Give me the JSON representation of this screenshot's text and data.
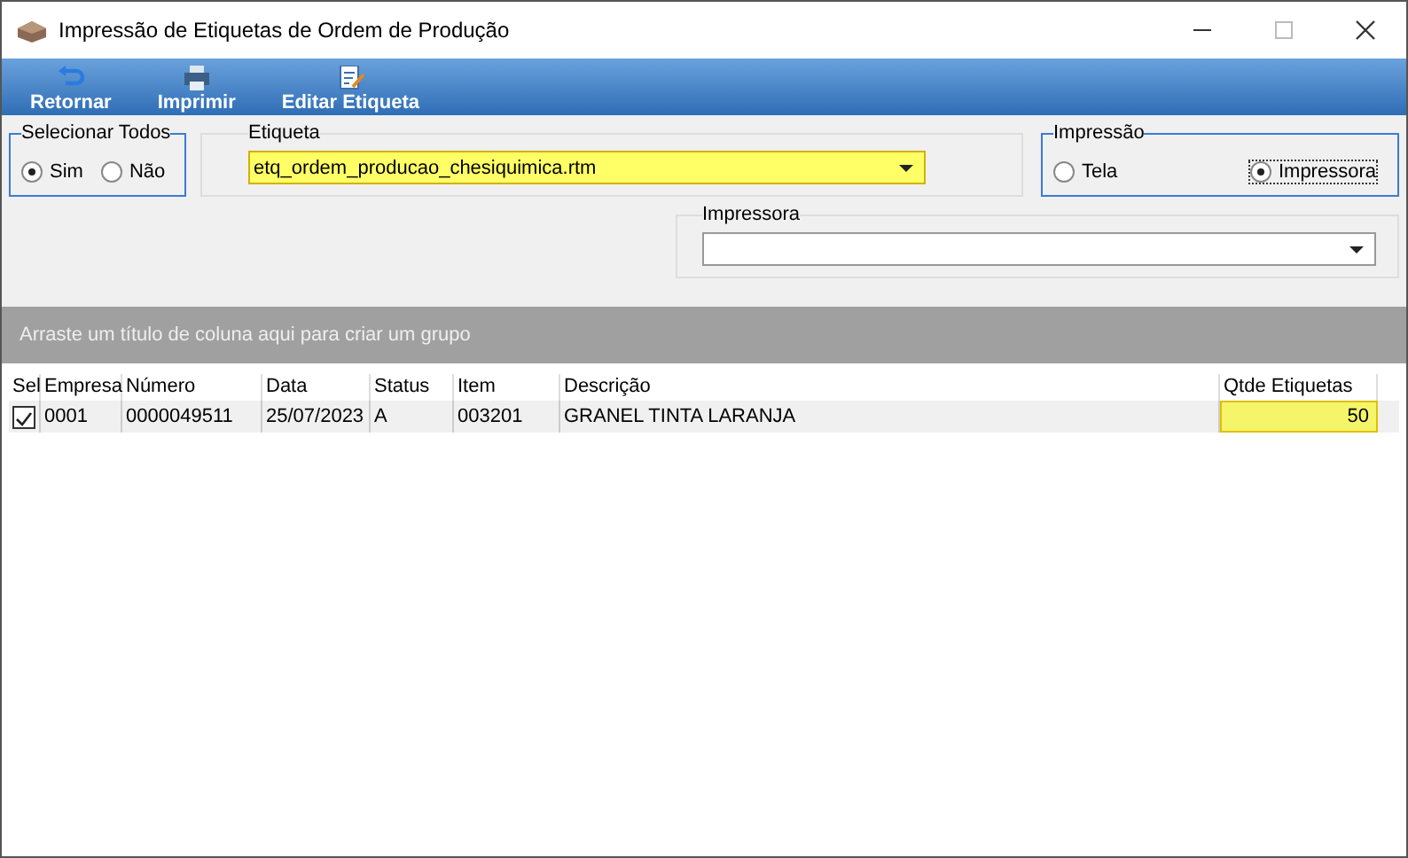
{
  "window": {
    "title": "Impressão de Etiquetas de Ordem de Produção"
  },
  "toolbar": [
    {
      "label": "Retornar",
      "kind": "return"
    },
    {
      "label": "Imprimir",
      "kind": "print"
    },
    {
      "label": "Editar Etiqueta",
      "kind": "edit"
    }
  ],
  "select_all": {
    "title": "Selecionar Todos",
    "options": [
      {
        "label": "Sim",
        "selected": true
      },
      {
        "label": "Não",
        "selected": false
      }
    ]
  },
  "etiqueta": {
    "label": "Etiqueta",
    "value": "etq_ordem_producao_chesiquimica.rtm"
  },
  "impressao": {
    "title": "Impressão",
    "options": [
      {
        "label": "Tela",
        "selected": false
      },
      {
        "label": "Impressora",
        "selected": true
      }
    ]
  },
  "impressora": {
    "label": "Impressora"
  },
  "group_hint": "Arraste um título de coluna aqui para criar um grupo",
  "table": {
    "select_column": "Sel",
    "columns": [
      "Empresa",
      "Número",
      "Data",
      "Status",
      "Item",
      "Descrição",
      "Qtde Etiquetas"
    ],
    "rows": [
      {
        "checked": true,
        "cells": [
          "0001",
          "0000049511",
          "25/07/2023",
          "A",
          "003201",
          "GRANEL TINTA LARANJA",
          "50"
        ]
      }
    ]
  }
}
